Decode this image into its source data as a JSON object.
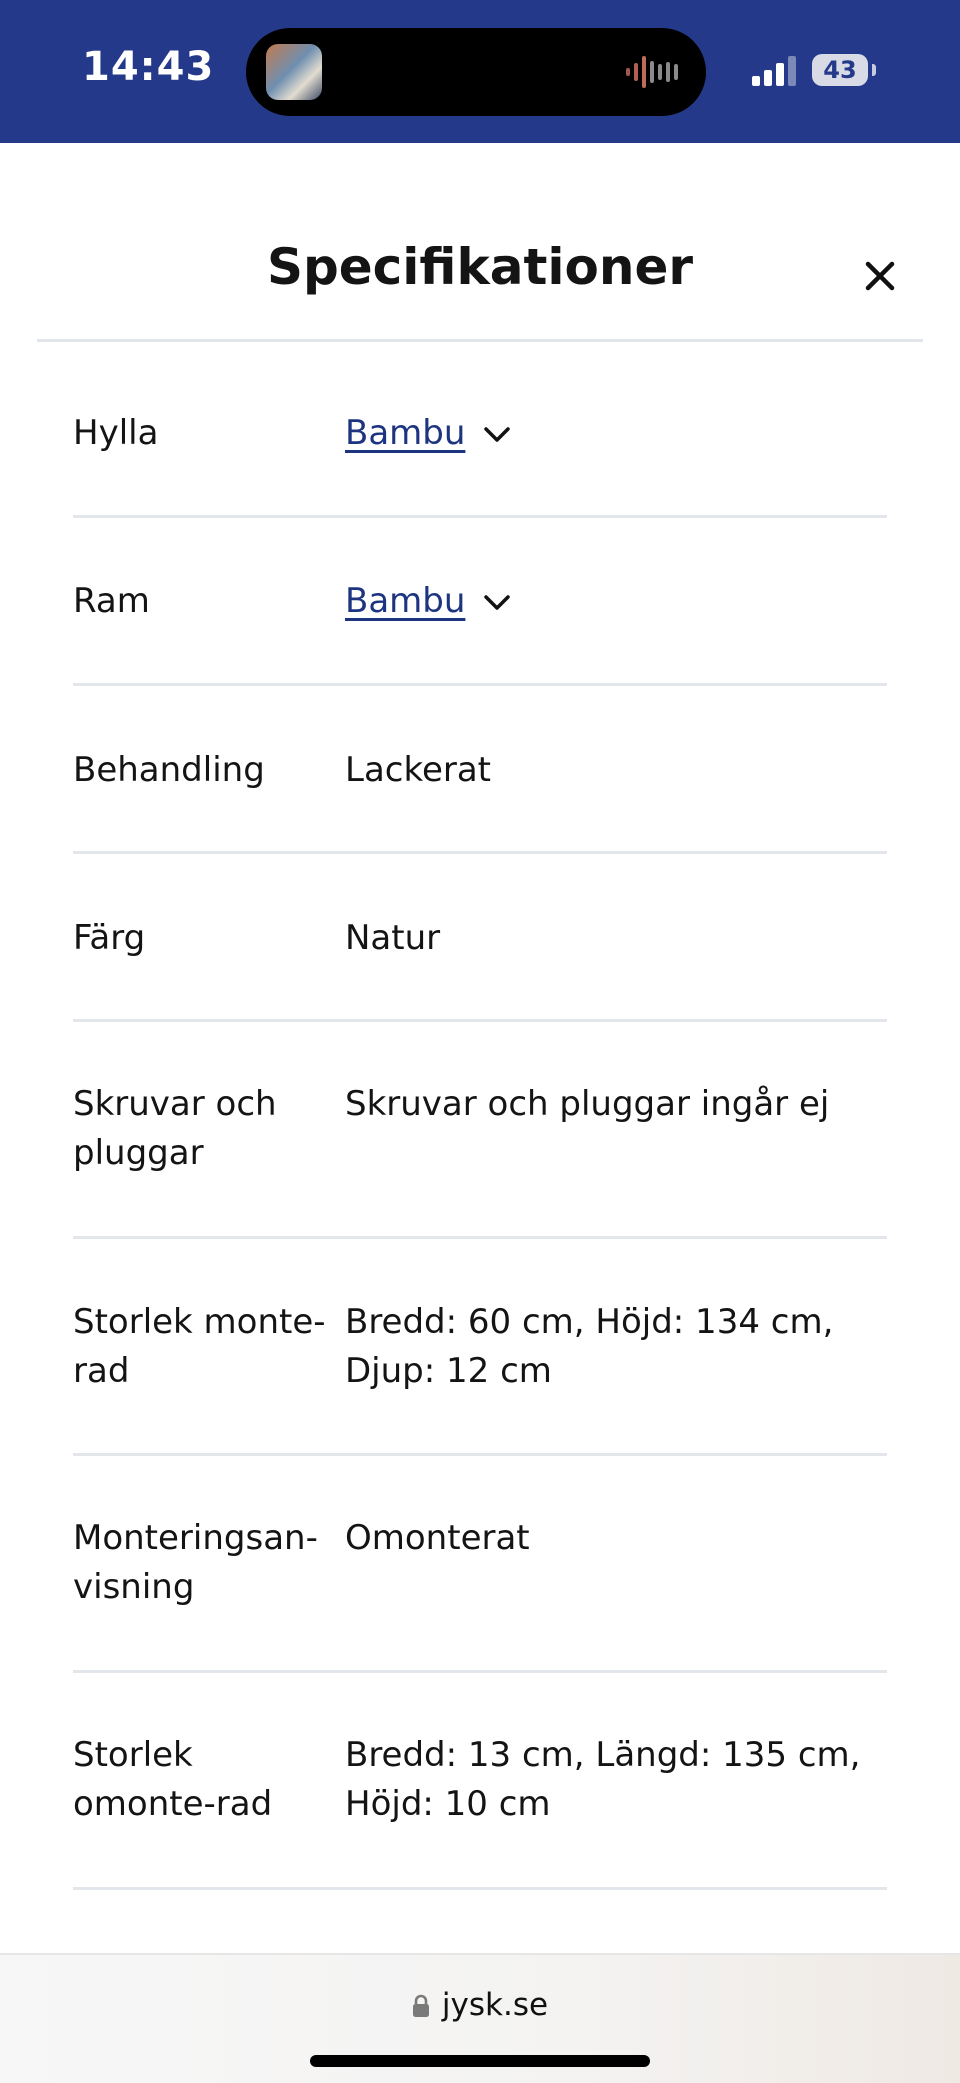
{
  "status_bar": {
    "time": "14:43",
    "battery": "43"
  },
  "header": {
    "title": "Specifikationer"
  },
  "specs": [
    {
      "label": "Hylla",
      "value": "Bambu",
      "link": true
    },
    {
      "label": "Ram",
      "value": "Bambu",
      "link": true
    },
    {
      "label": "Behandling",
      "value": "Lackerat",
      "link": false
    },
    {
      "label": "Färg",
      "value": "Natur",
      "link": false
    },
    {
      "label": "Skruvar och pluggar",
      "value": "Skruvar och pluggar ingår ej",
      "link": false
    },
    {
      "label": "Storlek monte-rad",
      "value": "Bredd: 60 cm, Höjd: 134 cm, Djup: 12 cm",
      "link": false
    },
    {
      "label": "Monteringsan-visning",
      "value": "Omonterat",
      "link": false
    },
    {
      "label": "Storlek omonte-rad",
      "value": "Bredd: 13 cm, Längd: 135 cm, Höjd: 10 cm",
      "link": false
    }
  ],
  "browser": {
    "url": "jysk.se"
  },
  "icons": {
    "close": "close-icon",
    "chevron": "chevron-down-icon",
    "lock": "lock-icon"
  },
  "colors": {
    "status_bar_bg": "#24398a",
    "link": "#1d3580",
    "divider": "#e3e6ea"
  }
}
